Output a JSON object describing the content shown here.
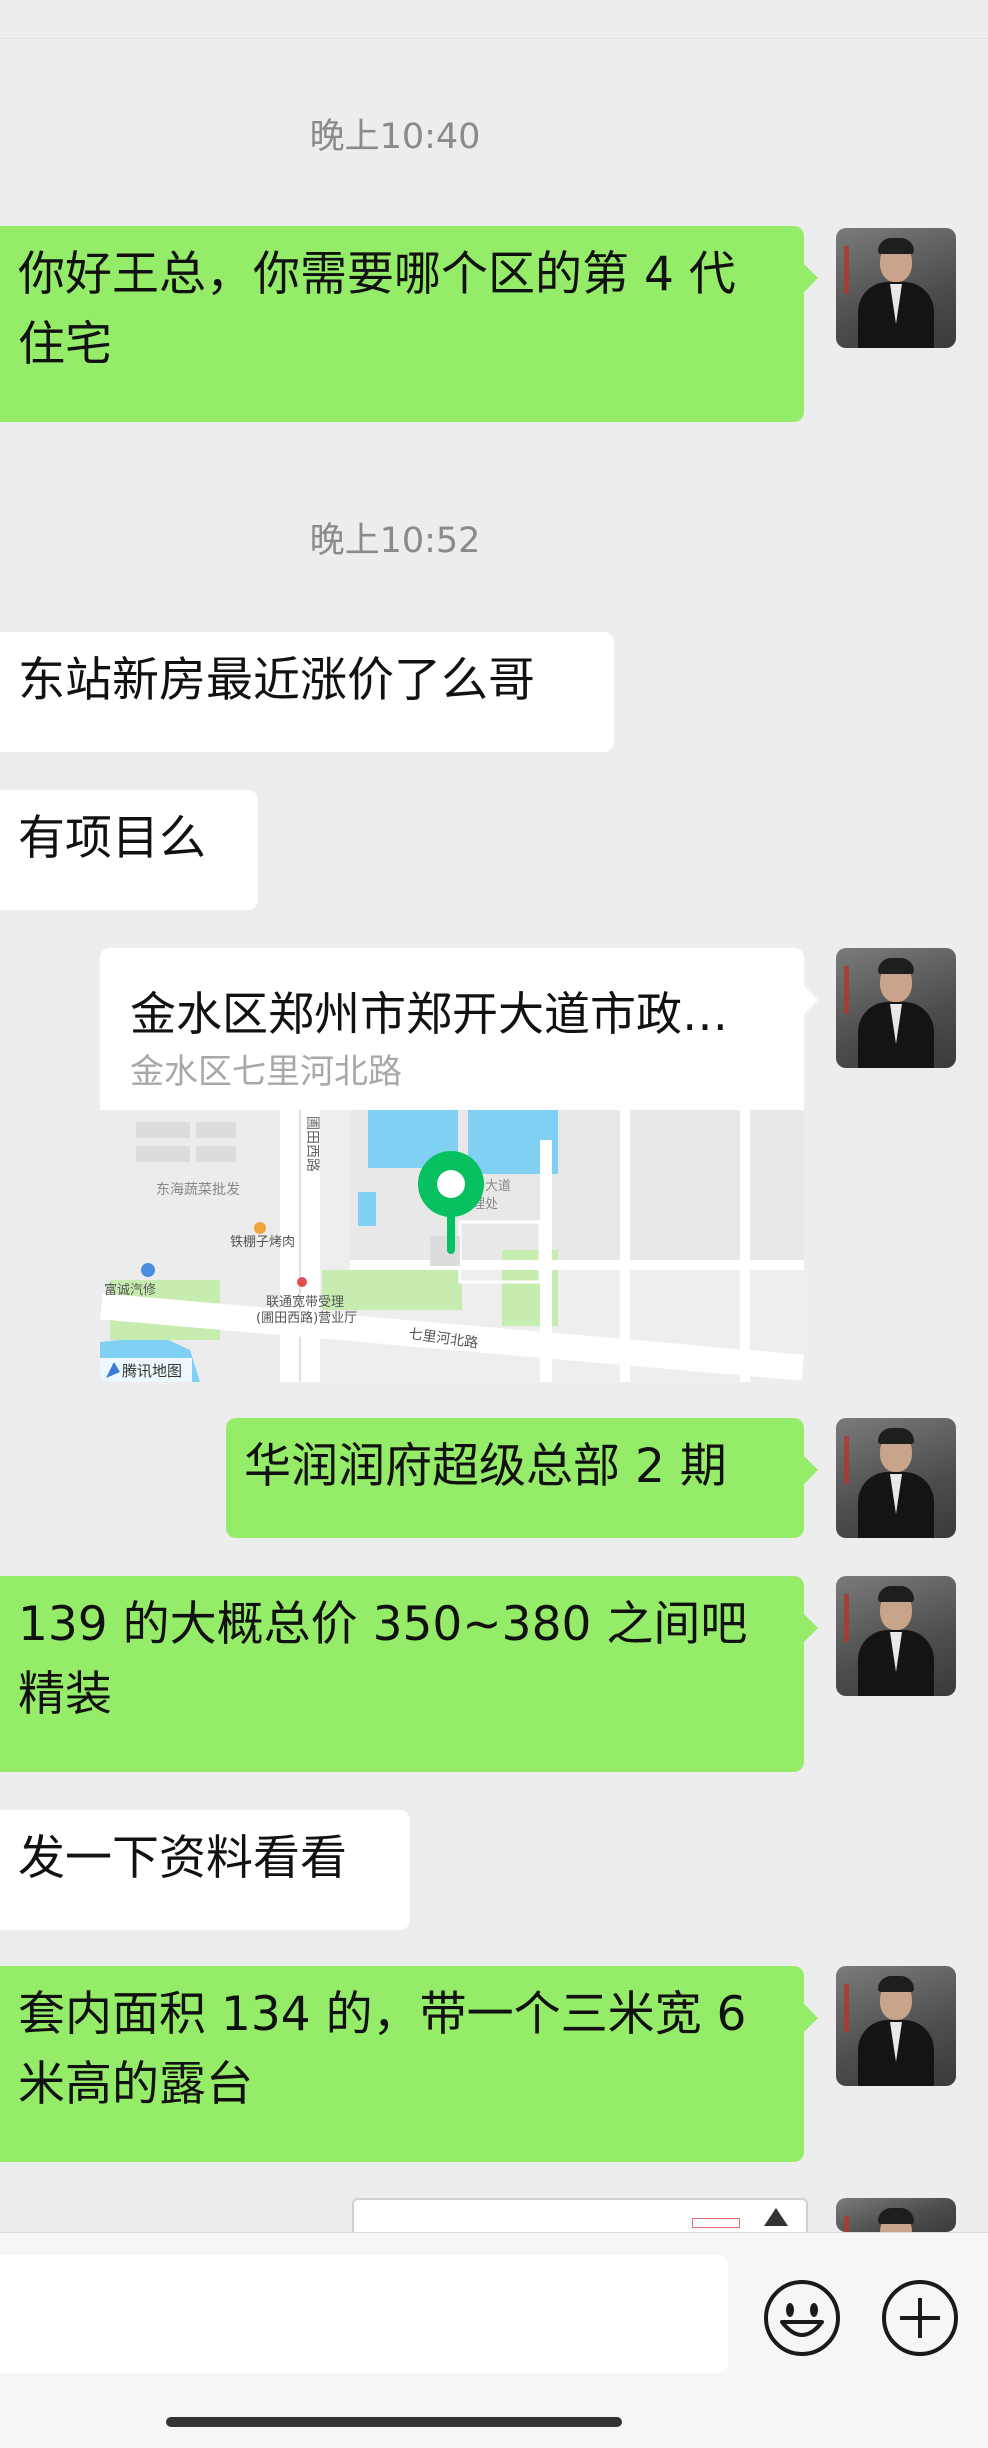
{
  "messages": {
    "time1": "晚上10:40",
    "m1_line1": "你好王总，你需要哪个区的第 4 代",
    "m1_line2": "住宅",
    "time2": "晚上10:52",
    "m2": "东站新房最近涨价了么哥",
    "m3": "有项目么",
    "m5": "华润润府超级总部 2 期",
    "m6_line1": "139 的大概总价 350~380 之间吧",
    "m6_line2": "精装",
    "m7": "发一下资料看看",
    "m8_line1": "套内面积 134 的，带一个三米宽 6",
    "m8_line2": "米高的露台"
  },
  "location": {
    "title": "金水区郑州市郑开大道市政…",
    "address": "金水区七里河北路",
    "map_labels": {
      "road_west": "圃田西路",
      "poi_wholesale": "东海蔬菜批发",
      "poi_bbq": "铁棚子烤肉",
      "poi_car": "富诚汽修",
      "poi_unicom": "联通宽带受理",
      "poi_unicom2": "(圃田西路)营业厅",
      "poi_admin": "开大道",
      "poi_admin2": "理处",
      "road_qili": "七里河北路",
      "brand": "腾讯地图"
    }
  },
  "colors": {
    "outgoing": "#95ec69",
    "incoming": "#ffffff",
    "background": "#ededed",
    "pin": "#07c160"
  },
  "icons": {
    "emoji": "smiley-icon",
    "plus": "plus-icon"
  }
}
